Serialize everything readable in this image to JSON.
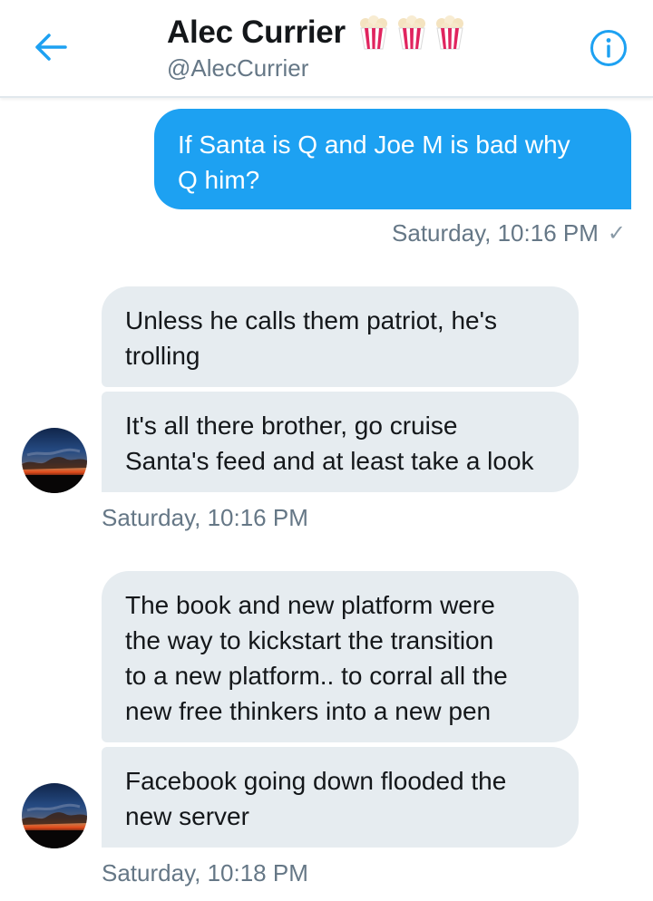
{
  "header": {
    "display_name": "Alec Currier",
    "handle": "@AlecCurrier",
    "emojis": [
      "popcorn-icon",
      "popcorn-icon",
      "popcorn-icon"
    ],
    "back_icon": "back-arrow-icon",
    "info_icon": "info-icon"
  },
  "colors": {
    "accent": "#1da1f2",
    "received_bubble": "#e6ecf0",
    "timestamp": "#657786"
  },
  "messages": [
    {
      "direction": "sent",
      "text": "If Santa is Q and Joe M is bad why\nQ him?"
    },
    {
      "direction": "received",
      "text": "Unless he calls them patriot, he's\ntrolling"
    },
    {
      "direction": "received",
      "text": "It's all there brother, go cruise\nSanta's feed and at least take a look"
    },
    {
      "direction": "received",
      "text": "The book and new platform were\nthe way to kickstart the transition\nto a new platform.. to corral all the\nnew free thinkers into a new pen"
    },
    {
      "direction": "received",
      "text": "Facebook going down flooded the\nnew server"
    }
  ],
  "timestamps": {
    "sent_1": "Saturday, 10:16 PM",
    "recv_1": "Saturday, 10:16 PM",
    "recv_2": "Saturday, 10:18 PM"
  }
}
